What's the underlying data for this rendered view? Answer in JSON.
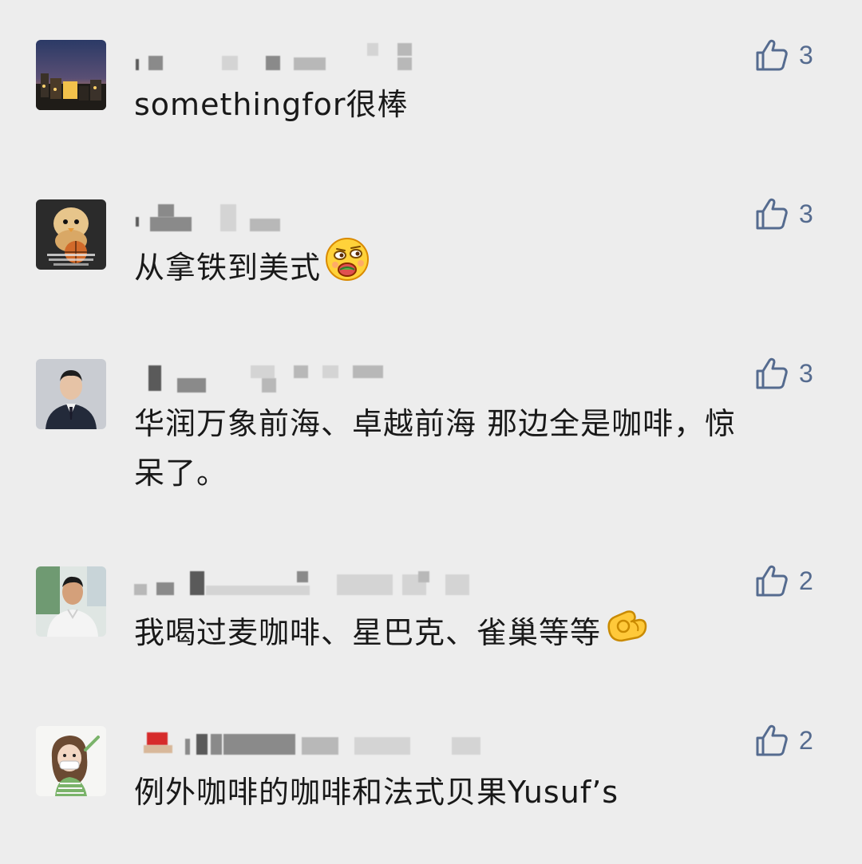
{
  "accent_color": "#556b8f",
  "background_color": "#ededed",
  "comments": [
    {
      "author_name": "",
      "text": "somethingfor很棒",
      "likes": "3",
      "emoji": null
    },
    {
      "author_name": "",
      "text": "从拿铁到美式",
      "likes": "3",
      "emoji": "smirk-face"
    },
    {
      "author_name": "",
      "text": "华润万象前海、卓越前海   那边全是咖啡，惊呆了。",
      "likes": "3",
      "emoji": null
    },
    {
      "author_name": "",
      "text": "我喝过麦咖啡、星巴克、雀巢等等",
      "likes": "2",
      "emoji": "ok-hand"
    },
    {
      "author_name": "",
      "text": "例外咖啡的咖啡和法式贝果Yusuf’s",
      "likes": "2",
      "emoji": null
    }
  ],
  "icons": {
    "like": "thumbs-up-icon"
  }
}
